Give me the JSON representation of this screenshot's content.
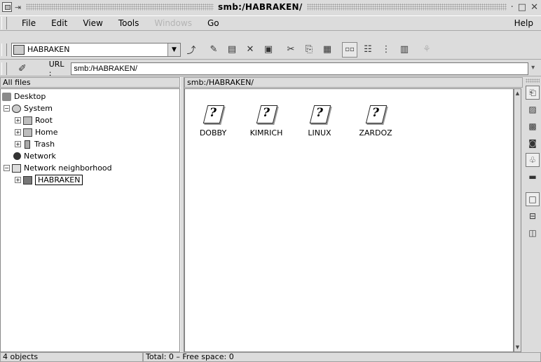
{
  "window": {
    "title": "smb:/HABRAKEN/",
    "buttons": [
      "·",
      "□",
      "✕"
    ]
  },
  "menu": {
    "items": [
      {
        "label": "File",
        "enabled": true
      },
      {
        "label": "Edit",
        "enabled": true
      },
      {
        "label": "View",
        "enabled": true
      },
      {
        "label": "Tools",
        "enabled": true
      },
      {
        "label": "Windows",
        "enabled": false
      },
      {
        "label": "Go",
        "enabled": true
      }
    ],
    "help": "Help"
  },
  "toolbar": {
    "combo_value": "HABRAKEN",
    "combo_arrow": "▼",
    "icons": [
      "up-icon",
      "new-folder-icon",
      "delete-icon",
      "x-icon",
      "properties-icon",
      "cut-icon",
      "copy-icon",
      "paste-icon",
      "icon-view-icon",
      "multicolumn-view-icon",
      "tree-view-icon",
      "detailed-view-icon",
      "find-icon"
    ]
  },
  "location": {
    "label": "URL :",
    "value": "smb:/HABRAKEN/"
  },
  "tree_panel": {
    "header": "All files",
    "items": [
      {
        "label": "Desktop"
      },
      {
        "label": "System"
      },
      {
        "label": "Root"
      },
      {
        "label": "Home"
      },
      {
        "label": "Trash"
      },
      {
        "label": "Network"
      },
      {
        "label": "Network neighborhood"
      },
      {
        "label": "HABRAKEN"
      }
    ]
  },
  "file_panel": {
    "header": "smb:/HABRAKEN/",
    "items": [
      {
        "label": "DOBBY",
        "icon": "?"
      },
      {
        "label": "KIMRICH",
        "icon": "?"
      },
      {
        "label": "LINUX",
        "icon": "?"
      },
      {
        "label": "ZARDOZ",
        "icon": "?"
      }
    ]
  },
  "status": {
    "objects": "4 objects",
    "space": "Total: 0 – Free space: 0"
  }
}
